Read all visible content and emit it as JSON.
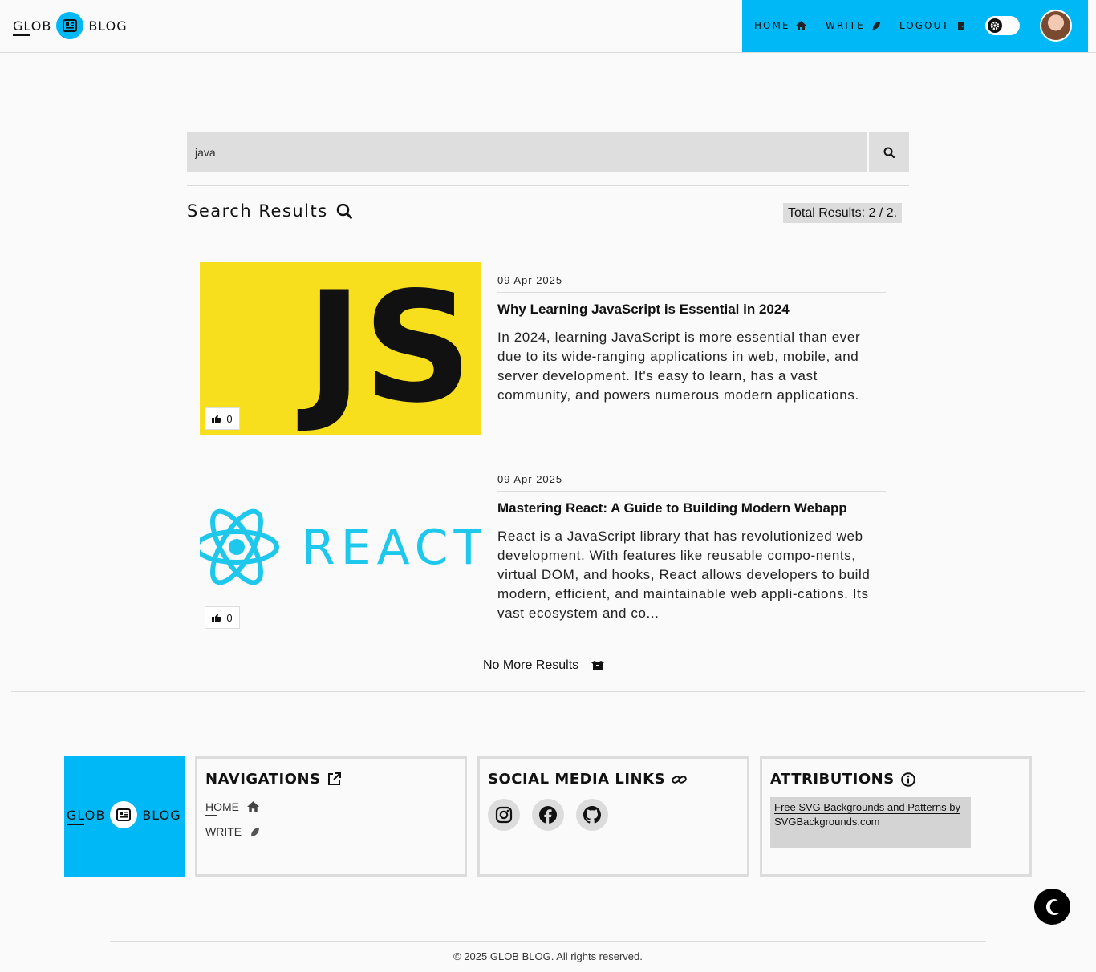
{
  "brand": {
    "left": "GLOB",
    "right": "BLOG",
    "accent_color": "#00b8f5"
  },
  "nav": {
    "items": [
      {
        "label": "HOME",
        "icon": "home-icon"
      },
      {
        "label": "WRITE",
        "icon": "feather-icon"
      },
      {
        "label": "LOGOUT",
        "icon": "door-icon"
      }
    ],
    "toggle_icon": "gear-icon",
    "avatar_icon": "user-avatar"
  },
  "search": {
    "value": "java",
    "button_icon": "search-icon"
  },
  "results": {
    "title": "Search Results",
    "title_icon": "search-icon",
    "total_label": "Total Results: 2 / 2."
  },
  "posts": [
    {
      "thumb_text": "JS",
      "thumb_bg": "#f7df1e",
      "likes": "0",
      "date": "09 Apr 2025",
      "title": "Why Learning JavaScript is Essential in 2024",
      "excerpt": "In 2024, learning JavaScript is more essential than ever due to its wide-ranging applications in web, mobile, and server development. It's easy to learn, has a vast community, and powers numerous modern applications."
    },
    {
      "thumb_text": "REACT",
      "thumb_bg": "#fafafa",
      "likes": "0",
      "date": "09 Apr 2025",
      "title": "Mastering React: A Guide to Building Modern Webapp",
      "excerpt": "React is a JavaScript library that has revolutionized web development. With features like reusable compo-nents, virtual DOM, and hooks, React allows developers to build modern, efficient, and maintainable web appli-cations. Its vast ecosystem and co..."
    }
  ],
  "no_more": {
    "label": "No More Results",
    "icon": "box-icon"
  },
  "footer": {
    "navigations": {
      "heading": "NAVIGATIONS",
      "heading_icon": "external-link-icon",
      "links": [
        {
          "label": "HOME",
          "icon": "home-icon"
        },
        {
          "label": "WRITE",
          "icon": "feather-icon"
        }
      ]
    },
    "social": {
      "heading": "SOCIAL MEDIA LINKS",
      "heading_icon": "link-icon",
      "icons": [
        "instagram-icon",
        "facebook-icon",
        "github-icon"
      ]
    },
    "attributions": {
      "heading": "ATTRIBUTIONS",
      "heading_icon": "info-icon",
      "text": "Free SVG Backgrounds and Patterns by SVGBackgrounds.com"
    },
    "copyright": "© 2025 GLOB BLOG. All rights reserved."
  },
  "dark_mode_icon": "moon-icon"
}
